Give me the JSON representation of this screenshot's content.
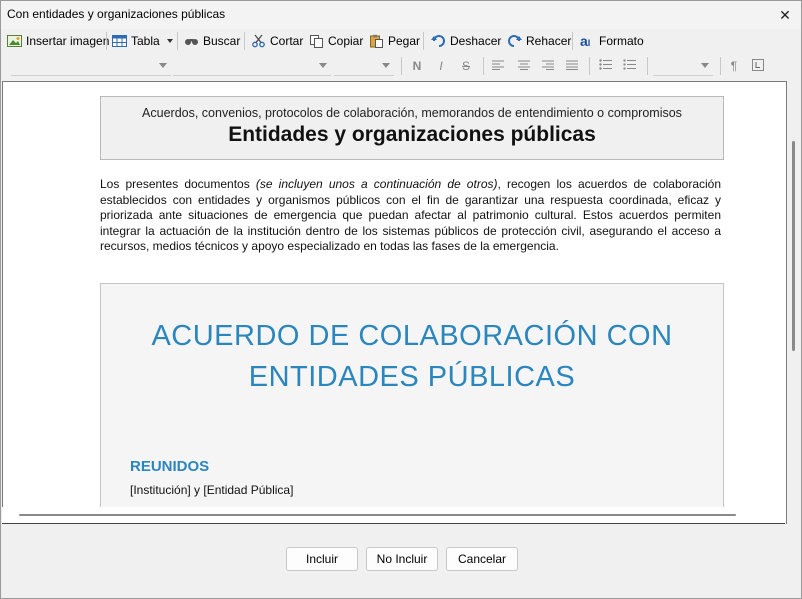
{
  "window": {
    "title": "Con entidades y organizaciones públicas",
    "close_glyph": "✕"
  },
  "toolbar": {
    "insert_image": "Insertar imagen",
    "table": "Tabla",
    "search": "Buscar",
    "cut": "Cortar",
    "copy": "Copiar",
    "paste": "Pegar",
    "undo": "Deshacer",
    "redo": "Rehacer",
    "format": "Formato"
  },
  "format_bar": {
    "bold": "N",
    "italic": "I",
    "strike": "S",
    "pilcrow": "¶"
  },
  "document": {
    "header_subtitle": "Acuerdos, convenios, protocolos de colaboración, memorandos de entendimiento o compromisos",
    "header_title": "Entidades y organizaciones públicas",
    "intro_part1": "Los presentes documentos ",
    "intro_italic": "(se incluyen unos a continuación de otros)",
    "intro_part2": ", recogen los acuerdos de colaboración establecidos con entidades y organismos públicos con el fin de garantizar una respuesta coordinada, eficaz y priorizada ante situaciones de emergencia que puedan afectar al patrimonio cultural. Estos acuerdos permiten integrar la actuación de la institución dentro de los sistemas públicos de protección civil, asegurando el acceso a recursos, medios técnicos y apoyo especializado en todas las fases de la emergencia.",
    "agreement_title_line1": "ACUERDO DE COLABORACIÓN CON",
    "agreement_title_line2": "ENTIDADES PÚBLICAS",
    "section_heading": "REUNIDOS",
    "parties": "[Institución] y [Entidad Pública]"
  },
  "footer": {
    "include": "Incluir",
    "not_include": "No Incluir",
    "cancel": "Cancelar"
  }
}
